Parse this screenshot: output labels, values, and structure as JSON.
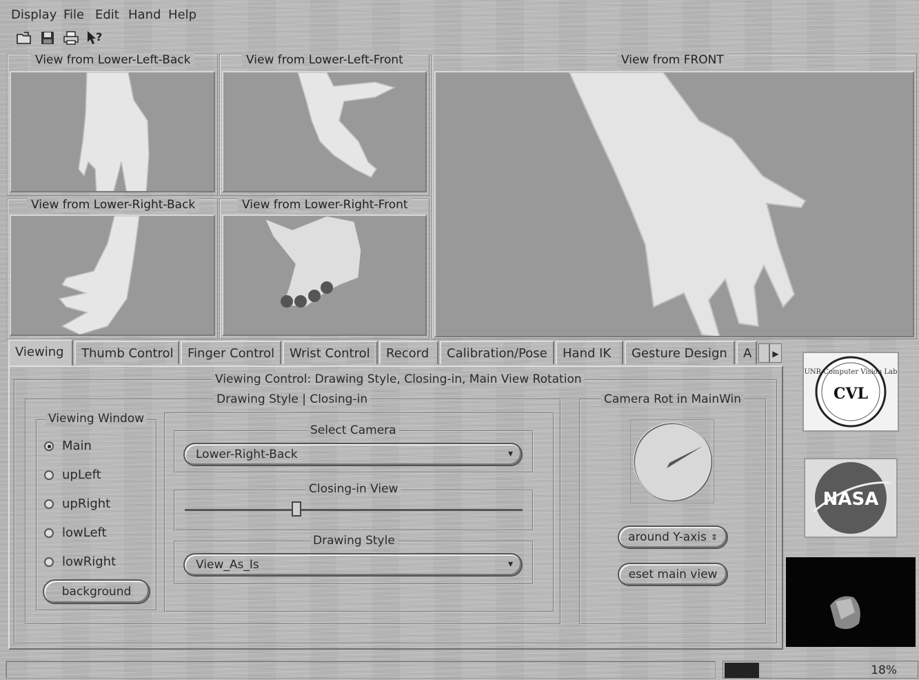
{
  "menubar": {
    "items": [
      "Display",
      "File",
      "Edit",
      "Hand",
      "Help"
    ]
  },
  "toolbar": {
    "icons": [
      "open-folder-icon",
      "save-disk-icon",
      "print-icon",
      "whats-this-help-icon"
    ]
  },
  "views": {
    "upper_left": "View from Lower-Left-Back",
    "upper_right": "View from Lower-Left-Front",
    "lower_left": "View from Lower-Right-Back",
    "lower_right": "View from Lower-Right-Front",
    "main": "View from FRONT"
  },
  "tabs": [
    {
      "label": "Viewing",
      "active": true
    },
    {
      "label": "Thumb Control"
    },
    {
      "label": "Finger Control"
    },
    {
      "label": "Wrist Control"
    },
    {
      "label": "Record"
    },
    {
      "label": "Calibration/Pose"
    },
    {
      "label": "Hand IK"
    },
    {
      "label": "Gesture Design"
    },
    {
      "label": "A"
    }
  ],
  "viewing_control": {
    "title": "Viewing Control: Drawing Style, Closing-in, Main View Rotation",
    "drawing_group_title": "Drawing Style | Closing-in",
    "viewing_window": {
      "title": "Viewing Window",
      "options": [
        "Main",
        "upLeft",
        "upRight",
        "lowLeft",
        "lowRight"
      ],
      "selected": "Main",
      "background_button": "background"
    },
    "select_camera": {
      "title": "Select Camera",
      "value": "Lower-Right-Back"
    },
    "closing_in": {
      "title": "Closing-in View",
      "value": 0.33
    },
    "drawing_style": {
      "title": "Drawing Style",
      "value": "View_As_Is"
    },
    "camera_rot": {
      "title": "Camera Rot in MainWin",
      "axis_button": "around Y-axis",
      "reset_button": "eset main view"
    }
  },
  "logos": {
    "cvl_text": "CVL",
    "cvl_ring": "UNR Computer Vision Lab",
    "nasa_text": "NASA"
  },
  "statusbar": {
    "progress_label": "18%",
    "progress": 0.18
  }
}
